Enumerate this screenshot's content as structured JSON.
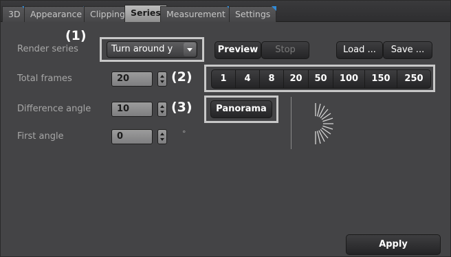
{
  "tabs": [
    {
      "label": "3D"
    },
    {
      "label": "Appearance"
    },
    {
      "label": "Clipping"
    },
    {
      "label": "Series",
      "active": true
    },
    {
      "label": "Measurement"
    },
    {
      "label": "Settings"
    }
  ],
  "render_series": {
    "label": "Render series",
    "value": "Turn around y",
    "callout": "(1)"
  },
  "preview_button": "Preview",
  "stop_button": "Stop",
  "load_button": "Load ...",
  "save_button": "Save ...",
  "total_frames": {
    "label": "Total frames",
    "value": "20",
    "callout": "(2)",
    "presets": [
      "1",
      "4",
      "8",
      "20",
      "50",
      "100",
      "150",
      "250"
    ]
  },
  "difference_angle": {
    "label": "Difference angle",
    "value": "10",
    "callout": "(3)"
  },
  "panorama_button": "Panorama",
  "first_angle": {
    "label": "First angle",
    "value": "0",
    "unit": "°"
  },
  "apply_button": "Apply",
  "colors": {
    "panel_bg": "#444446",
    "label": "#a7a7a7",
    "tab_corner_accent": "#2f8ad8",
    "highlight_box": "#c8c8c8"
  }
}
